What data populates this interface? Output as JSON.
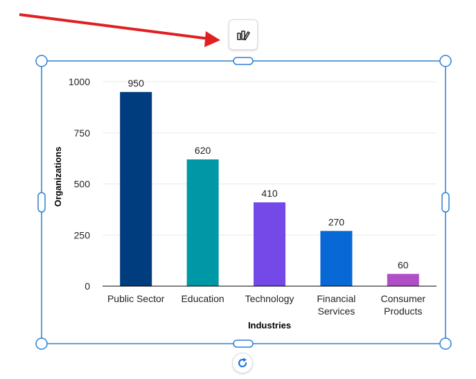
{
  "colors": {
    "selection": "#2b7fd4",
    "arrow": "#e02020",
    "axis": "#000000",
    "grid": "#e8e8e8",
    "bars": [
      "#003d7f",
      "#0097a7",
      "#7548e8",
      "#0868d6",
      "#b04ec8"
    ]
  },
  "icons": {
    "chart_style_button": "paintbrush-icon",
    "rotate_button": "rotate-icon"
  },
  "chart_data": {
    "type": "bar",
    "categories": [
      [
        "Public Sector"
      ],
      [
        "Education"
      ],
      [
        "Technology"
      ],
      [
        "Financial",
        "Services"
      ],
      [
        "Consumer",
        "Products"
      ]
    ],
    "values": [
      950,
      620,
      410,
      270,
      60
    ],
    "data_labels": [
      "950",
      "620",
      "410",
      "270",
      "60"
    ],
    "title": "",
    "xlabel": "Industries",
    "ylabel": "Organizations",
    "ylim": [
      0,
      1000
    ],
    "yticks": [
      0,
      250,
      500,
      750,
      1000
    ],
    "grid": true,
    "legend": "none"
  }
}
